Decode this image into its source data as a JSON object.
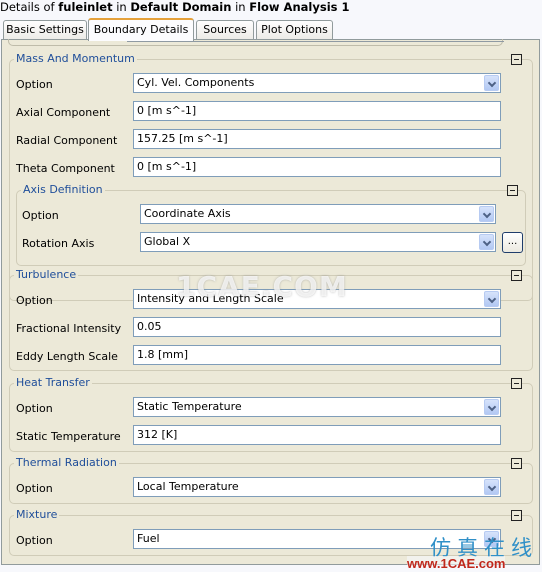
{
  "header": {
    "prefix": "Details of",
    "object": "fuleinlet",
    "in1": "in",
    "domain": "Default Domain",
    "in2": "in",
    "analysis": "Flow Analysis 1"
  },
  "tabs": [
    {
      "label": "Basic Settings",
      "active": false
    },
    {
      "label": "Boundary Details",
      "active": true
    },
    {
      "label": "Sources",
      "active": false
    },
    {
      "label": "Plot Options",
      "active": false
    }
  ],
  "mass_momentum": {
    "title": "Mass And Momentum",
    "option_label": "Option",
    "option_value": "Cyl. Vel. Components",
    "axial_label": "Axial Component",
    "axial_value": "0 [m s^-1]",
    "radial_label": "Radial Component",
    "radial_value": "157.25 [m s^-1]",
    "theta_label": "Theta Component",
    "theta_value": "0 [m s^-1]",
    "axis_definition": {
      "title": "Axis Definition",
      "option_label": "Option",
      "option_value": "Coordinate Axis",
      "rotation_label": "Rotation Axis",
      "rotation_value": "Global X",
      "browse_label": "..."
    }
  },
  "turbulence": {
    "title": "Turbulence",
    "option_label": "Option",
    "option_value": "Intensity and Length Scale",
    "intensity_label": "Fractional Intensity",
    "intensity_value": "0.05",
    "eddy_label": "Eddy Length Scale",
    "eddy_value": "1.8 [mm]"
  },
  "heat_transfer": {
    "title": "Heat Transfer",
    "option_label": "Option",
    "option_value": "Static Temperature",
    "temp_label": "Static Temperature",
    "temp_value": "312 [K]"
  },
  "thermal_radiation": {
    "title": "Thermal Radiation",
    "option_label": "Option",
    "option_value": "Local Temperature"
  },
  "mixture": {
    "title": "Mixture",
    "option_label": "Option",
    "option_value": "Fuel"
  },
  "watermarks": {
    "center": "1CAE.COM",
    "cn": "仿真在线",
    "url": "www.1CAE.com"
  },
  "colors": {
    "group_title": "#1f4e9a",
    "panel_bg": "#ece9d8",
    "active_tab_accent": "#e5a13b"
  }
}
